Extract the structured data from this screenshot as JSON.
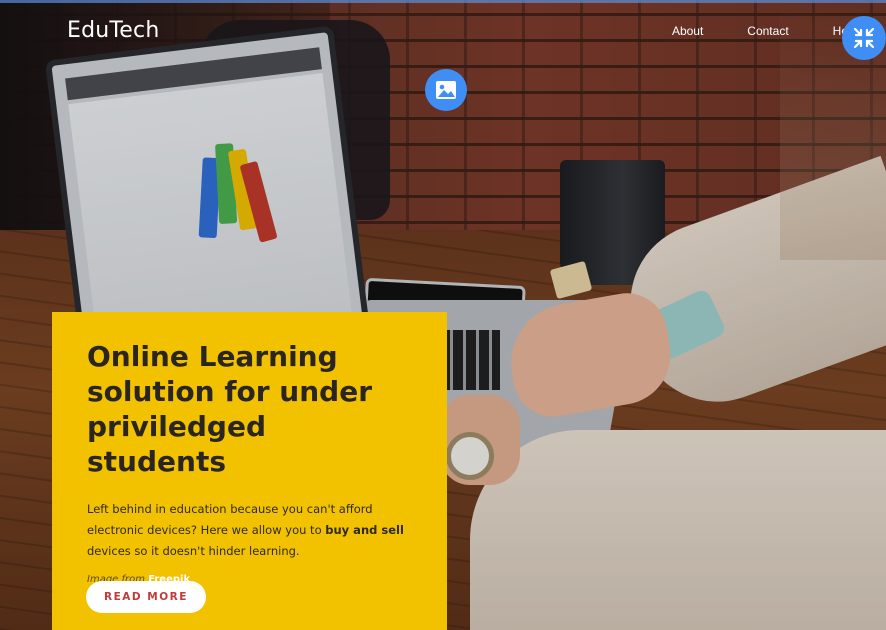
{
  "nav": {
    "brand": "EduTech",
    "links": [
      "About",
      "Contact",
      "He"
    ]
  },
  "controls": {
    "collapse_icon": "collapse-arrows-icon",
    "image_icon": "image-icon",
    "accent_color": "#3f8ef5"
  },
  "hero": {
    "title": "Online Learning solution for under priviledged students",
    "text_before": "Left behind in education because you can't afford electronic devices? Here we allow you to ",
    "text_bold": "buy and sell",
    "text_after": " devices so it doesn't hinder learning.",
    "credit_prefix": "Image from",
    "credit_link": "Freepik",
    "button_label": "READ MORE",
    "card_color": "#f2c200"
  }
}
